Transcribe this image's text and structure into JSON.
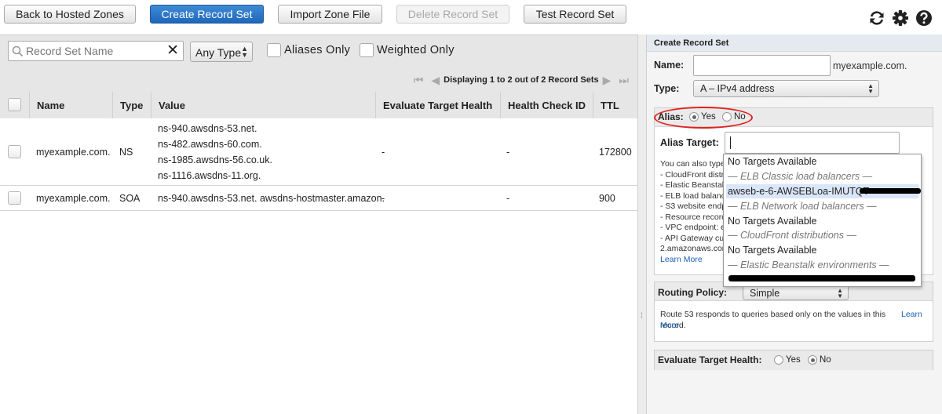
{
  "toolbar": {
    "back_label": "Back to Hosted Zones",
    "create_label": "Create Record Set",
    "import_label": "Import Zone File",
    "delete_label": "Delete Record Set",
    "test_label": "Test Record Set"
  },
  "filters": {
    "search_placeholder": "Record Set Name",
    "clear_glyph": "✕",
    "type_value": "Any Type",
    "aliases_only": "Aliases Only",
    "weighted_only": "Weighted Only"
  },
  "pager": {
    "text": "Displaying 1 to 2 out of 2 Record Sets"
  },
  "table": {
    "columns": [
      "Name",
      "Type",
      "Value",
      "Evaluate Target Health",
      "Health Check ID",
      "TTL"
    ],
    "rows": [
      {
        "name": "myexample.com.",
        "type": "NS",
        "values": [
          "ns-940.awsdns-53.net.",
          "ns-482.awsdns-60.com.",
          "ns-1985.awsdns-56.co.uk.",
          "ns-1116.awsdns-11.org."
        ],
        "eval": "-",
        "health": "-",
        "ttl": "172800"
      },
      {
        "name": "myexample.com.",
        "type": "SOA",
        "values": [
          "ns-940.awsdns-53.net. awsdns-hostmaster.amazon."
        ],
        "eval": "-",
        "health": "-",
        "ttl": "900"
      }
    ]
  },
  "form": {
    "title": "Create Record Set",
    "name_label": "Name:",
    "name_suffix": "myexample.com.",
    "type_label": "Type:",
    "type_value": "A – IPv4 address",
    "alias_label": "Alias:",
    "alias_yes": "Yes",
    "alias_no": "No",
    "alias_target_label": "Alias Target:",
    "help_lines": [
      "You can also type",
      "- CloudFront distri",
      "- Elastic Beanstal",
      "- ELB load balanc",
      "- S3 website endp",
      "- Resource record",
      "- VPC endpoint: e",
      "- API Gateway cu",
      "2.amazonaws.com"
    ],
    "learn_more": "Learn More",
    "routing_label": "Routing Policy:",
    "routing_value": "Simple",
    "routing_help": "Route 53 responds to queries based only on the values in this record.",
    "routing_learn_1": "Learn",
    "routing_learn_2": "More",
    "eval_label": "Evaluate Target Health:",
    "eval_yes": "Yes",
    "eval_no": "No"
  },
  "dropdown": {
    "items": [
      {
        "text": "No Targets Available",
        "kind": "item"
      },
      {
        "text": "— ELB Classic load balancers —",
        "kind": "group"
      },
      {
        "text": "awseb-e-6-AWSEBLoa-IMUTQT",
        "kind": "selected"
      },
      {
        "text": "— ELB Network load balancers —",
        "kind": "group"
      },
      {
        "text": "No Targets Available",
        "kind": "item"
      },
      {
        "text": "— CloudFront distributions —",
        "kind": "group"
      },
      {
        "text": "No Targets Available",
        "kind": "item"
      },
      {
        "text": "— Elastic Beanstalk environments —",
        "kind": "group"
      }
    ]
  },
  "colors": {
    "primary": "#1f66b8",
    "highlight": "#e02020",
    "link": "#1b5fb4"
  }
}
